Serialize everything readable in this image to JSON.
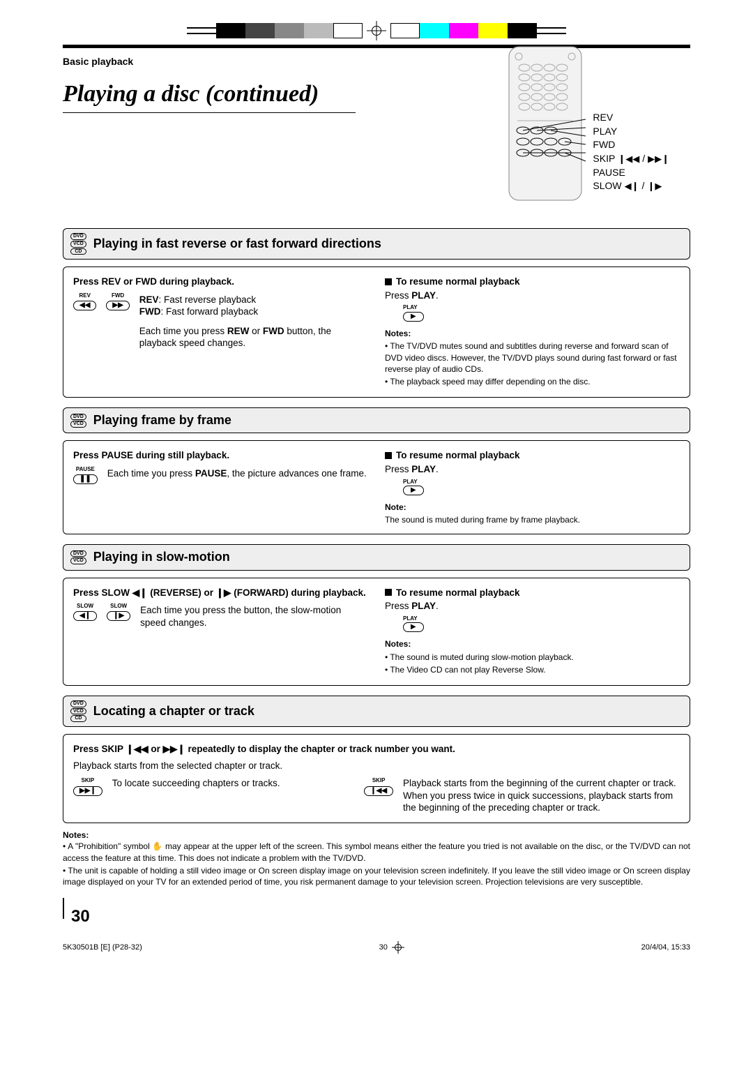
{
  "header": {
    "chapter": "Basic playback",
    "title": "Playing a disc (continued)"
  },
  "remote": {
    "labels": [
      "REV",
      "PLAY",
      "FWD"
    ],
    "skip": "SKIP",
    "pause": "PAUSE",
    "slow": "SLOW"
  },
  "sections": [
    {
      "badges": [
        "DVD",
        "VCD",
        "CD"
      ],
      "title": "Playing in fast reverse or fast forward directions",
      "left": {
        "instruction": "Press REV or FWD during playback.",
        "icons": [
          {
            "label": "REV",
            "glyph": "◀◀"
          },
          {
            "label": "FWD",
            "glyph": "▶▶"
          }
        ],
        "lines": [
          {
            "b": "REV",
            "t": ": Fast reverse playback"
          },
          {
            "b": "FWD",
            "t": ": Fast forward playback"
          }
        ],
        "para": [
          "Each time you press ",
          "REW",
          " or ",
          "FWD",
          " button, the playback speed changes."
        ]
      },
      "right": {
        "resume": "To resume normal playback",
        "press": [
          "Press ",
          "PLAY",
          "."
        ],
        "play_icon": {
          "label": "PLAY",
          "glyph": "▶"
        },
        "notes_label": "Notes:",
        "notes": [
          "The TV/DVD mutes sound and subtitles during reverse and forward scan of DVD video discs. However, the TV/DVD plays sound during fast forward or fast reverse play of audio CDs.",
          "The playback speed may differ depending on the disc."
        ]
      }
    },
    {
      "badges": [
        "DVD",
        "VCD"
      ],
      "title": "Playing frame by frame",
      "left": {
        "instruction": "Press PAUSE during still playback.",
        "icons": [
          {
            "label": "PAUSE",
            "glyph": "❚❚"
          }
        ],
        "para": [
          "Each time you press ",
          "PAUSE",
          ", the picture advances one frame."
        ]
      },
      "right": {
        "resume": "To resume normal playback",
        "press": [
          "Press ",
          "PLAY",
          "."
        ],
        "play_icon": {
          "label": "PLAY",
          "glyph": "▶"
        },
        "notes_label": "Note:",
        "note_single": "The sound is muted during frame by frame playback."
      }
    },
    {
      "badges": [
        "DVD",
        "VCD"
      ],
      "title": "Playing in slow-motion",
      "left": {
        "instruction_parts": [
          "Press SLOW ",
          "◀❙",
          " (REVERSE) or ",
          "❙▶",
          " (FORWARD) during playback."
        ],
        "icons": [
          {
            "label": "SLOW",
            "glyph": "◀❙"
          },
          {
            "label": "SLOW",
            "glyph": "❙▶"
          }
        ],
        "para_plain": "Each time you press the button, the slow-motion speed changes."
      },
      "right": {
        "resume": "To resume normal playback",
        "press": [
          "Press ",
          "PLAY",
          "."
        ],
        "play_icon": {
          "label": "PLAY",
          "glyph": "▶"
        },
        "notes_label": "Notes:",
        "notes": [
          "The sound is muted during slow-motion playback.",
          "The Video CD can not play Reverse Slow."
        ]
      }
    },
    {
      "badges": [
        "DVD",
        "VCD",
        "CD"
      ],
      "title": "Locating a chapter or track",
      "full": {
        "instruction_parts": [
          "Press SKIP ",
          "❙◀◀",
          " or ",
          "▶▶❙",
          " repeatedly to display the chapter or track number you want."
        ],
        "sub": "Playback starts from the selected chapter or track.",
        "left_icon": {
          "label": "SKIP",
          "glyph": "▶▶❙"
        },
        "left_text": "To locate succeeding chapters or tracks.",
        "right_icon": {
          "label": "SKIP",
          "glyph": "❙◀◀"
        },
        "right_text": "Playback starts from the beginning of the current chapter or track.\nWhen you press twice in quick successions, playback starts from the beginning of the preceding chapter or track."
      }
    }
  ],
  "bottom_notes": {
    "label": "Notes:",
    "items": [
      "A \"Prohibition\" symbol ✋ may appear at the upper left of the screen. This symbol means either the feature you tried is not available on the disc, or the TV/DVD can not access the feature at this time. This does not indicate a problem with the TV/DVD.",
      "The unit is capable of holding a still video image or On screen display image on your television screen indefinitely. If you leave the still video image or On screen display image displayed on your TV for an extended period of time, you risk permanent damage to your television screen.  Projection televisions are very susceptible."
    ]
  },
  "page_number": "30",
  "footer": {
    "left": "5K30501B [E] (P28-32)",
    "center": "30",
    "right": "20/4/04, 15:33"
  }
}
